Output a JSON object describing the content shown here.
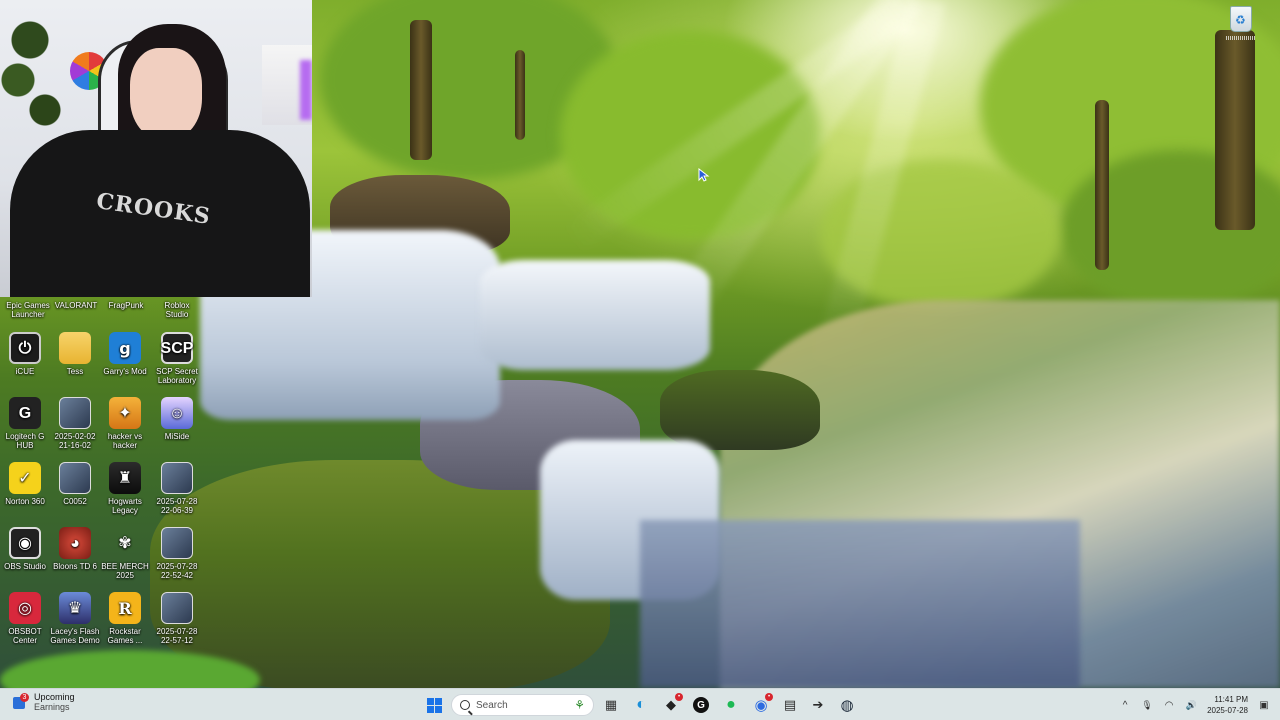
{
  "desktop": {
    "top_row_labels": [
      {
        "label": "Epic Games\nLauncher"
      },
      {
        "label": "VALORANT"
      },
      {
        "label": "FragPunk"
      },
      {
        "label": "Roblox\nStudio"
      }
    ],
    "icons": [
      {
        "label": "iCUE",
        "glyph": "⏻"
      },
      {
        "label": "Tess",
        "glyph": ""
      },
      {
        "label": "Garry's Mod",
        "glyph": "g"
      },
      {
        "label": "SCP Secret\nLaboratory",
        "glyph": "SCP"
      },
      {
        "label": "Logitech G\nHUB",
        "glyph": "G"
      },
      {
        "label": "2025-02-02\n21-16-02",
        "glyph": ""
      },
      {
        "label": "hacker vs\nhacker",
        "glyph": "✦"
      },
      {
        "label": "MiSide",
        "glyph": "☺"
      },
      {
        "label": "Norton 360",
        "glyph": "✓"
      },
      {
        "label": "C0052",
        "glyph": ""
      },
      {
        "label": "Hogwarts\nLegacy",
        "glyph": "♜"
      },
      {
        "label": "2025-07-28\n22-06-39",
        "glyph": ""
      },
      {
        "label": "OBS Studio",
        "glyph": "◉"
      },
      {
        "label": "Bloons TD 6",
        "glyph": "◕"
      },
      {
        "label": "BEE MERCH\n2025",
        "glyph": "✾"
      },
      {
        "label": "2025-07-28\n22-52-42",
        "glyph": ""
      },
      {
        "label": "OBSBOT\nCenter",
        "glyph": "◎"
      },
      {
        "label": "Lacey's Flash\nGames Demo",
        "glyph": "♛"
      },
      {
        "label": "Rockstar\nGames ...",
        "glyph": "R"
      },
      {
        "label": "2025-07-28\n22-57-12",
        "glyph": ""
      }
    ],
    "recycle_bin_glyph": "♻"
  },
  "webcam": {
    "hoodie_text": "CROOKS"
  },
  "taskbar": {
    "weather": {
      "title": "Upcoming",
      "subtitle": "Earnings",
      "badge": "3"
    },
    "search_placeholder": "Search",
    "search_plant": "⚘",
    "apps": [
      {
        "name": "file-explorer",
        "glyph": "▦",
        "color": "#333333"
      },
      {
        "name": "edge",
        "glyph": "◐",
        "color": "#1a8fd8"
      },
      {
        "name": "app-badged",
        "glyph": "◆",
        "color": "#222222",
        "badge": "•"
      },
      {
        "name": "logitech",
        "glyph": "G",
        "color": "#111111"
      },
      {
        "name": "spotify",
        "glyph": "●",
        "color": "#1db954"
      },
      {
        "name": "messenger",
        "glyph": "◉",
        "color": "#2d6be0",
        "badge": "•"
      },
      {
        "name": "terminal",
        "glyph": "▤",
        "color": "#2a2a2a"
      },
      {
        "name": "arrow-app",
        "glyph": "➔",
        "color": "#2a2a2a"
      },
      {
        "name": "steam",
        "glyph": "◍",
        "color": "#1b2838"
      }
    ],
    "tray": {
      "chevron": "^",
      "mic": "🎙",
      "wifi": "◠",
      "volume": "🔊",
      "time": "11:41 PM",
      "date": "2025-07-28",
      "notification": "▣"
    }
  }
}
